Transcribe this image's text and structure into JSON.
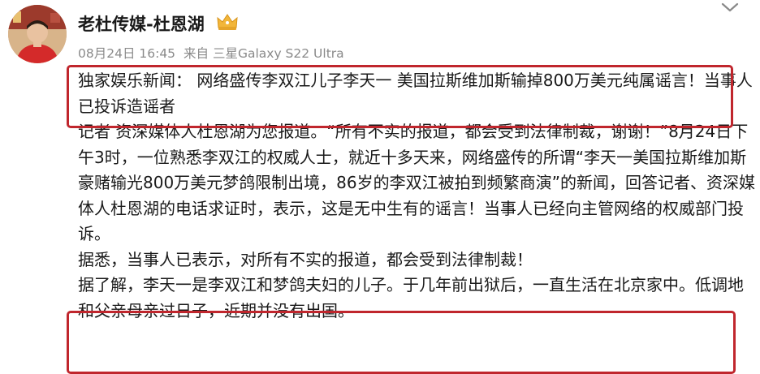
{
  "post": {
    "author": "老杜传媒-杜恩湖",
    "date": "08月24日 16:45",
    "source": "来自 三星Galaxy S22 Ultra",
    "headline": "独家娱乐新闻：  网络盛传李双江儿子李天一 美国拉斯维加斯输掉800万美元纯属谣言！当事人已投诉造谣者",
    "paragraph_1": "记者 资深媒体人杜恩湖为您报道。“所有不实的报道，都会受到法律制裁，谢谢！”8月24日下午3时，一位熟悉李双江的权威人士，就近十多天来，网络盛传的所谓“李天一美国拉斯维加斯豪赌输光800万美元梦鸽限制出境，86岁的李双江被拍到频繁商演”的新闻，回答记者、资深媒体人杜恩湖的电话求证时，表示，这是无中生有的谣言！当事人已经向主管网络的权威部门投诉。",
    "paragraph_2": "据悉，当事人已表示，对所有不实的报道，都会受到法律制裁！",
    "paragraph_3": "据了解，李天一是李双江和梦鸽夫妇的儿子。于几年前出狱后，一直生活在北京家中。低调地和父亲母亲过日子，近期并没有出国。"
  },
  "icons": {
    "badge": "crown-icon",
    "menu": "chevron-down-icon",
    "avatar": "avatar"
  },
  "colors": {
    "highlight_box": "#c0262d",
    "meta_text": "#8a8a8a",
    "body_text": "#1a1a1a"
  }
}
